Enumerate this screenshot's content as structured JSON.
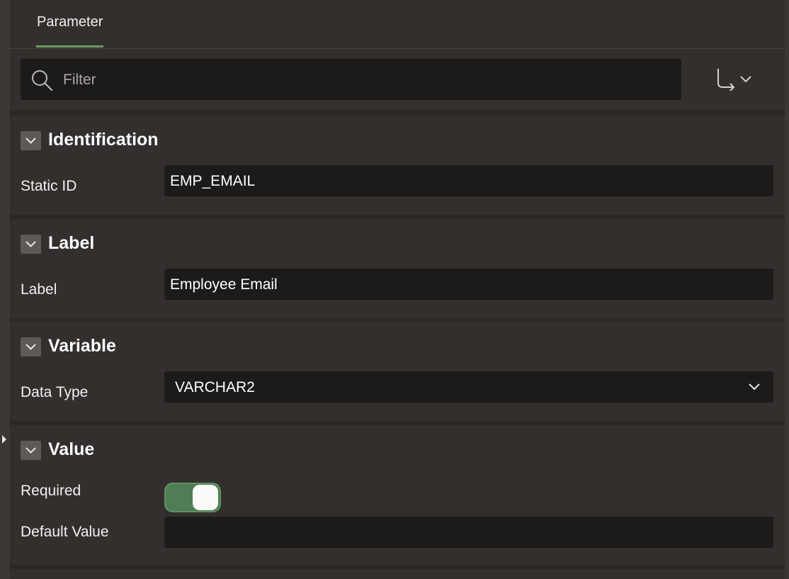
{
  "tabs": [
    {
      "label": "Parameter",
      "active": true
    }
  ],
  "toolbar": {
    "filter_placeholder": "Filter",
    "filter_value": ""
  },
  "sections": {
    "identification": {
      "title": "Identification",
      "static_id_label": "Static ID",
      "static_id_value": "EMP_EMAIL"
    },
    "label": {
      "title": "Label",
      "label_label": "Label",
      "label_value": "Employee Email"
    },
    "variable": {
      "title": "Variable",
      "data_type_label": "Data Type",
      "data_type_value": "VARCHAR2"
    },
    "value": {
      "title": "Value",
      "required_label": "Required",
      "required_on": true,
      "default_value_label": "Default Value",
      "default_value": ""
    }
  },
  "colors": {
    "accent": "#6f9a6b",
    "toggle_on": "#4f7d55",
    "panel_bg": "#322f2c",
    "field_bg": "#1c1b1a"
  },
  "icons": [
    "search-icon",
    "go-to-group-icon",
    "chevron-down-icon",
    "collapse-chevron-icon"
  ]
}
